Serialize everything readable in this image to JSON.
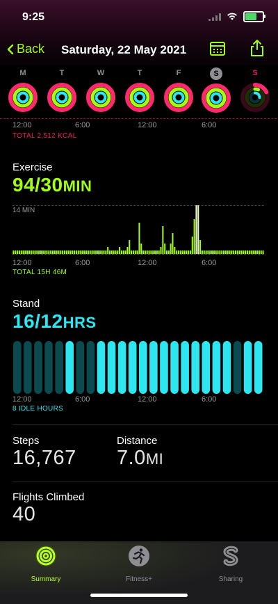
{
  "status": {
    "time": "9:25"
  },
  "nav": {
    "back_label": "Back",
    "title": "Saturday, 22 May 2021"
  },
  "week": {
    "days": [
      {
        "letter": "M",
        "state": "complete"
      },
      {
        "letter": "T",
        "state": "complete"
      },
      {
        "letter": "W",
        "state": "complete"
      },
      {
        "letter": "T",
        "state": "complete"
      },
      {
        "letter": "F",
        "state": "complete"
      },
      {
        "letter": "S",
        "state": "selected"
      },
      {
        "letter": "S",
        "state": "today"
      }
    ]
  },
  "move": {
    "axis": [
      "12:00",
      "6:00",
      "12:00",
      "6:00"
    ],
    "total": "TOTAL 2,512 KCAL"
  },
  "exercise": {
    "title": "Exercise",
    "value": "94/30",
    "unit": "MIN",
    "scale_label": "14 MIN",
    "axis": [
      "12:00",
      "6:00",
      "12:00",
      "6:00"
    ],
    "total": "TOTAL 15H 46M",
    "color": "#a3ff12",
    "minutes_per_slot": [
      1,
      1,
      1,
      1,
      1,
      1,
      1,
      1,
      1,
      1,
      1,
      1,
      1,
      1,
      1,
      1,
      1,
      1,
      1,
      1,
      1,
      1,
      1,
      1,
      1,
      1,
      1,
      1,
      1,
      1,
      1,
      1,
      1,
      1,
      1,
      1,
      1,
      1,
      1,
      1,
      1,
      1,
      1,
      1,
      1,
      1,
      1,
      1,
      2,
      1,
      1,
      1,
      1,
      1,
      2,
      1,
      1,
      1,
      2,
      4,
      1,
      1,
      1,
      1,
      9,
      3,
      1,
      1,
      1,
      1,
      1,
      1,
      1,
      1,
      1,
      2,
      8,
      3,
      1,
      1,
      3,
      6,
      2,
      1,
      1,
      1,
      1,
      1,
      1,
      1,
      1,
      5,
      10,
      14,
      14,
      4,
      1,
      1,
      1,
      1,
      1,
      1,
      1,
      1,
      1,
      1,
      1,
      1,
      1,
      1,
      1,
      1,
      1,
      1,
      1,
      1,
      1,
      1,
      1,
      1,
      1,
      1,
      1,
      1,
      1,
      1,
      1,
      1
    ]
  },
  "stand": {
    "title": "Stand",
    "value": "16/12",
    "unit": "HRS",
    "axis": [
      "12:00",
      "6:00",
      "12:00",
      "6:00"
    ],
    "idle": "8 IDLE HOURS",
    "color": "#2ee6f0",
    "hours": [
      0,
      0,
      0,
      0,
      0,
      1,
      0,
      0,
      1,
      1,
      1,
      1,
      1,
      1,
      1,
      1,
      1,
      1,
      1,
      1,
      1,
      0,
      1,
      1
    ]
  },
  "steps": {
    "label": "Steps",
    "value": "16,767"
  },
  "distance": {
    "label": "Distance",
    "value": "7.0",
    "unit": "MI"
  },
  "flights": {
    "label": "Flights Climbed",
    "value": "40"
  },
  "tabs": [
    {
      "label": "Summary",
      "active": true
    },
    {
      "label": "Fitness+",
      "active": false
    },
    {
      "label": "Sharing",
      "active": false
    }
  ]
}
